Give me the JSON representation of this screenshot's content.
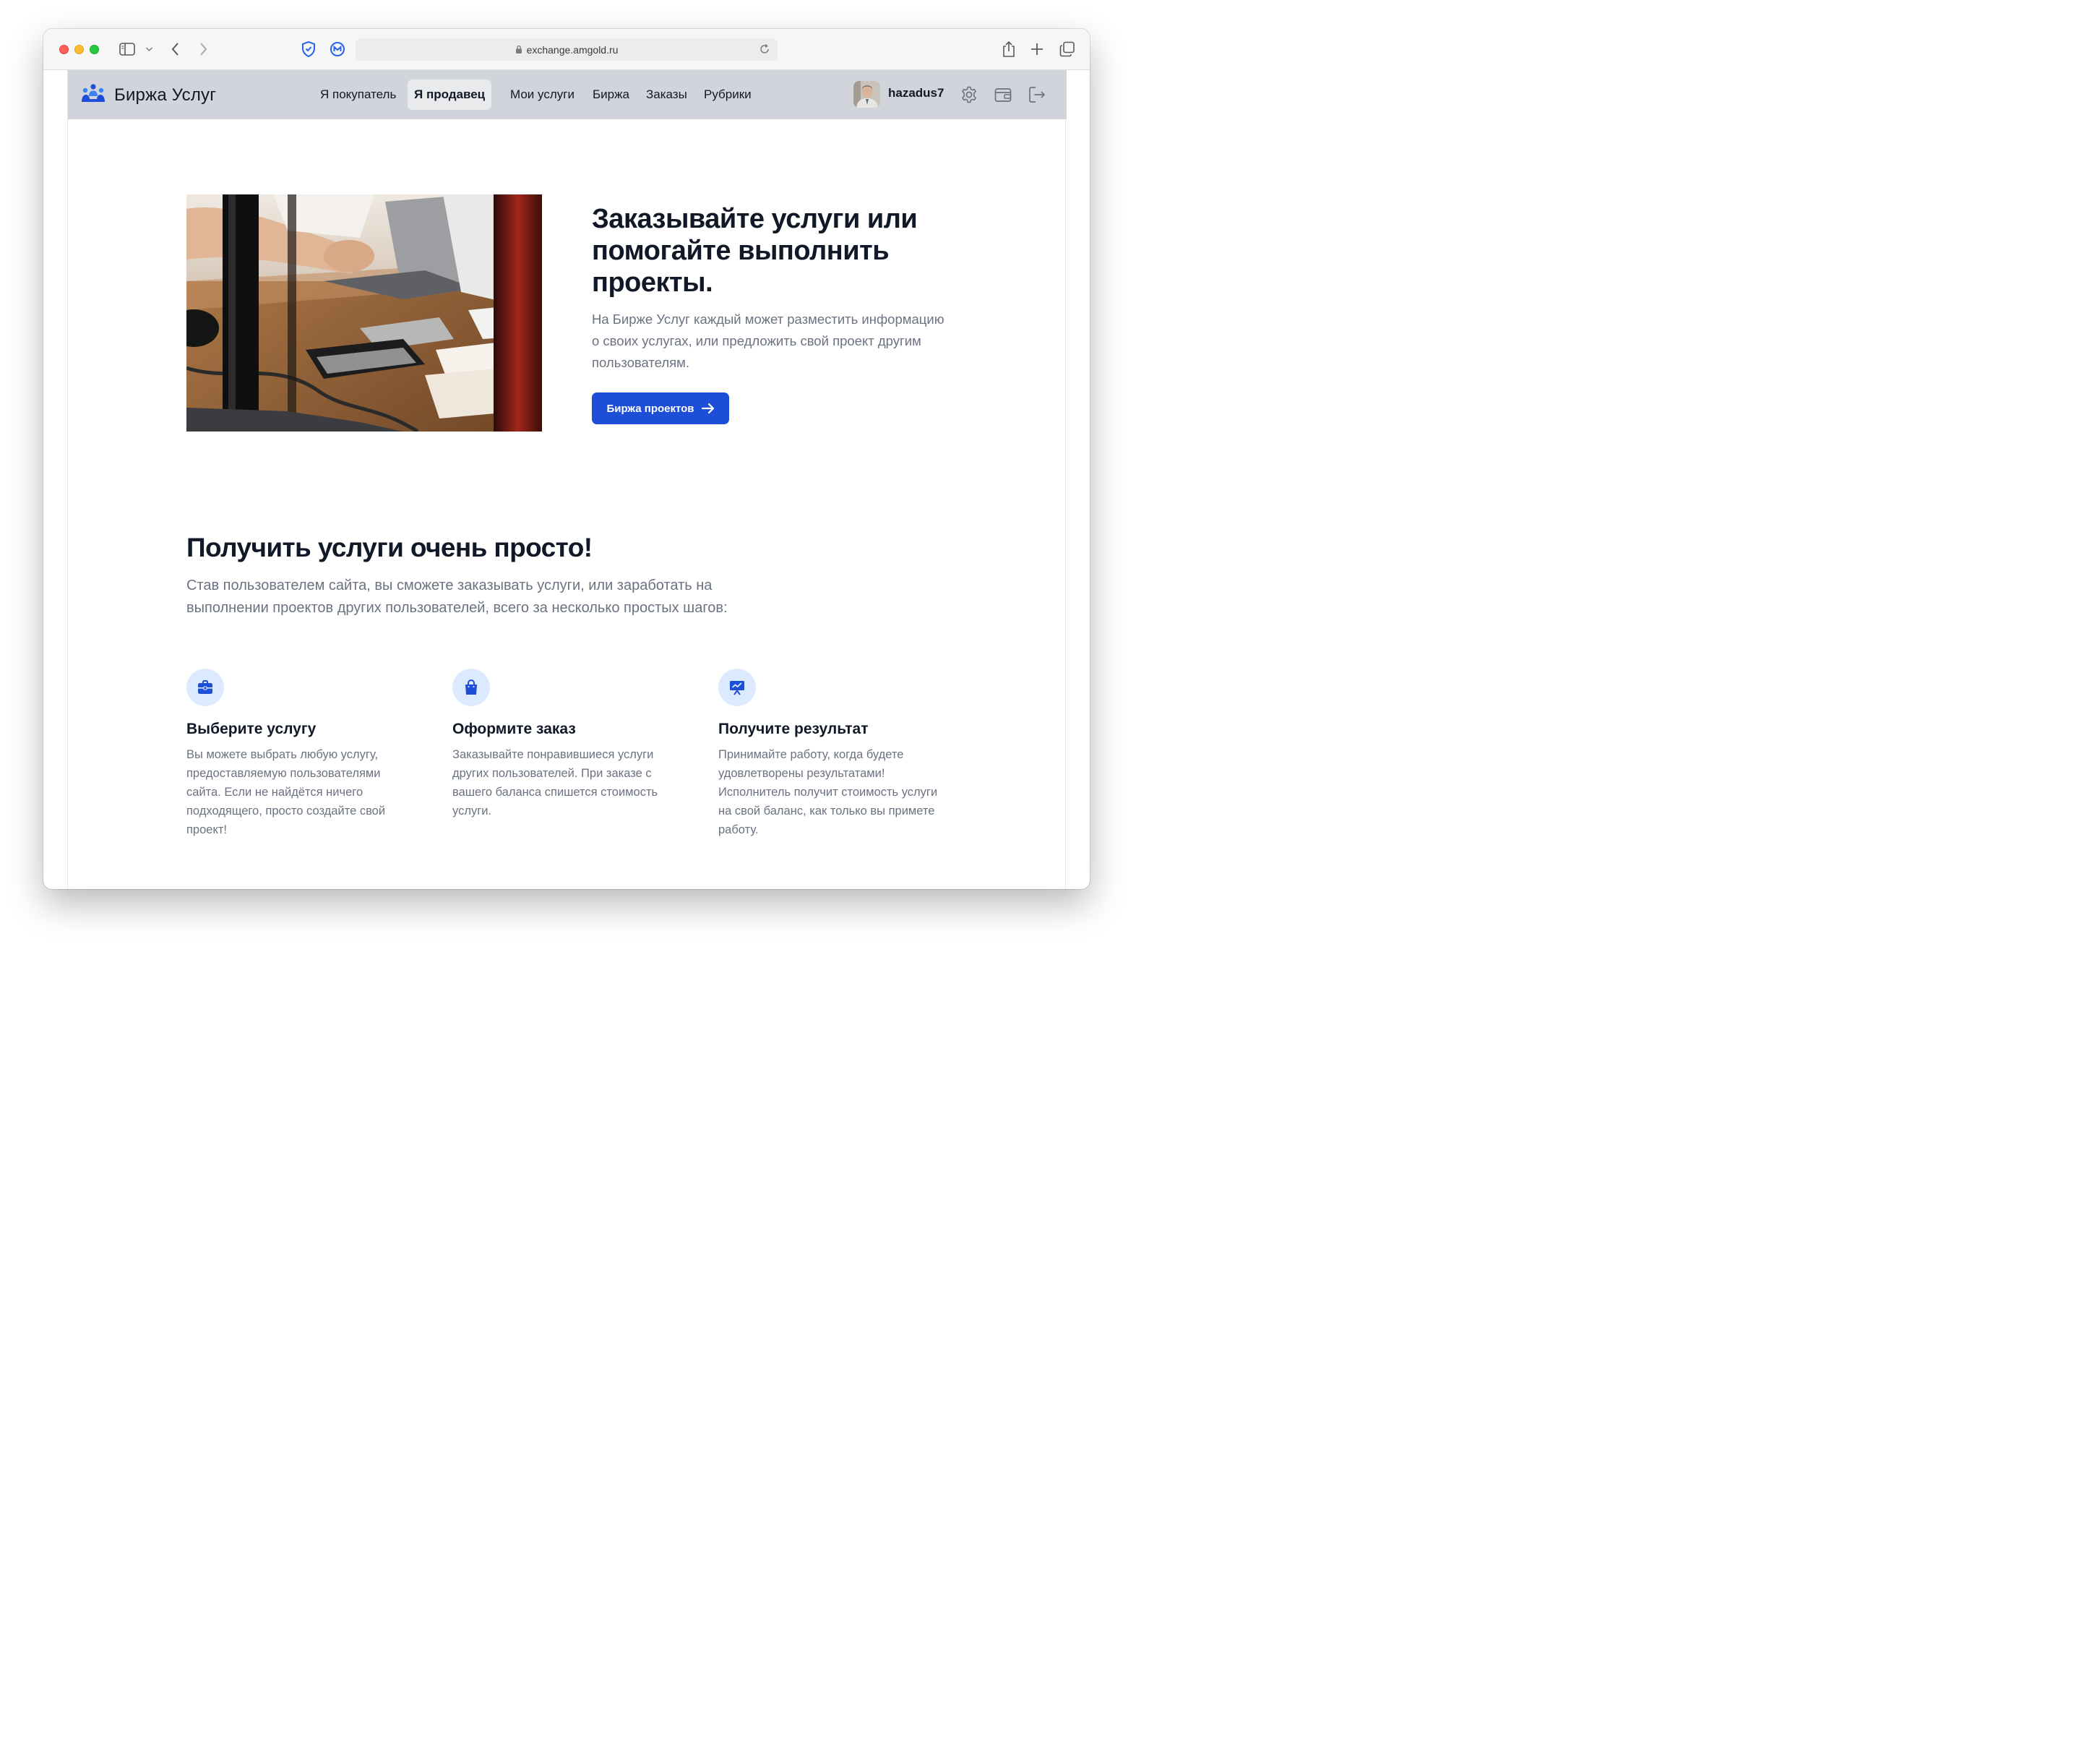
{
  "browser": {
    "url": "exchange.amgold.ru"
  },
  "navbar": {
    "brand": "Биржа Услуг",
    "items": [
      {
        "label": "Я покупатель",
        "active": false
      },
      {
        "label": "Я продавец",
        "active": true
      },
      {
        "label": "Мои услуги",
        "active": false
      },
      {
        "label": "Биржа",
        "active": false
      },
      {
        "label": "Заказы",
        "active": false
      },
      {
        "label": "Рубрики",
        "active": false
      }
    ],
    "username": "hazadus7",
    "icons": [
      "settings-icon",
      "wallet-icon",
      "logout-icon"
    ]
  },
  "hero": {
    "title": "Заказывайте услуги или помогайте выполнить проекты.",
    "text": "На Бирже Услуг каждый может разместить информацию о своих услугах, или предложить свой проект другим пользователям.",
    "button_label": "Биржа проектов"
  },
  "steps_section": {
    "title": "Получить услуги очень просто!",
    "text": "Став пользователем сайта, вы сможете заказывать услуги, или заработать на выполнении проектов других пользователей, всего за несколько простых шагов:",
    "features": [
      {
        "icon": "briefcase-icon",
        "title": "Выберите услугу",
        "text": "Вы можете выбрать любую услугу, предоставляемую пользователями сайта. Если не найдётся ничего подходящего, просто создайте свой проект!"
      },
      {
        "icon": "shopping-bag-icon",
        "title": "Оформите заказ",
        "text": "Заказывайте понравившиеся услуги других пользователей. При заказе с вашего баланса спишется стоимость услуги."
      },
      {
        "icon": "chart-presentation-icon",
        "title": "Получите результат",
        "text": "Принимайте работу, когда будете удовлетворены результатами! Исполнитель получит стоимость услуги на свой баланс, как только вы примете работу."
      }
    ]
  },
  "colors": {
    "accent": "#1d4ed8",
    "navbar_bg": "#d1d5db",
    "icon_bg": "#dbeafe"
  }
}
